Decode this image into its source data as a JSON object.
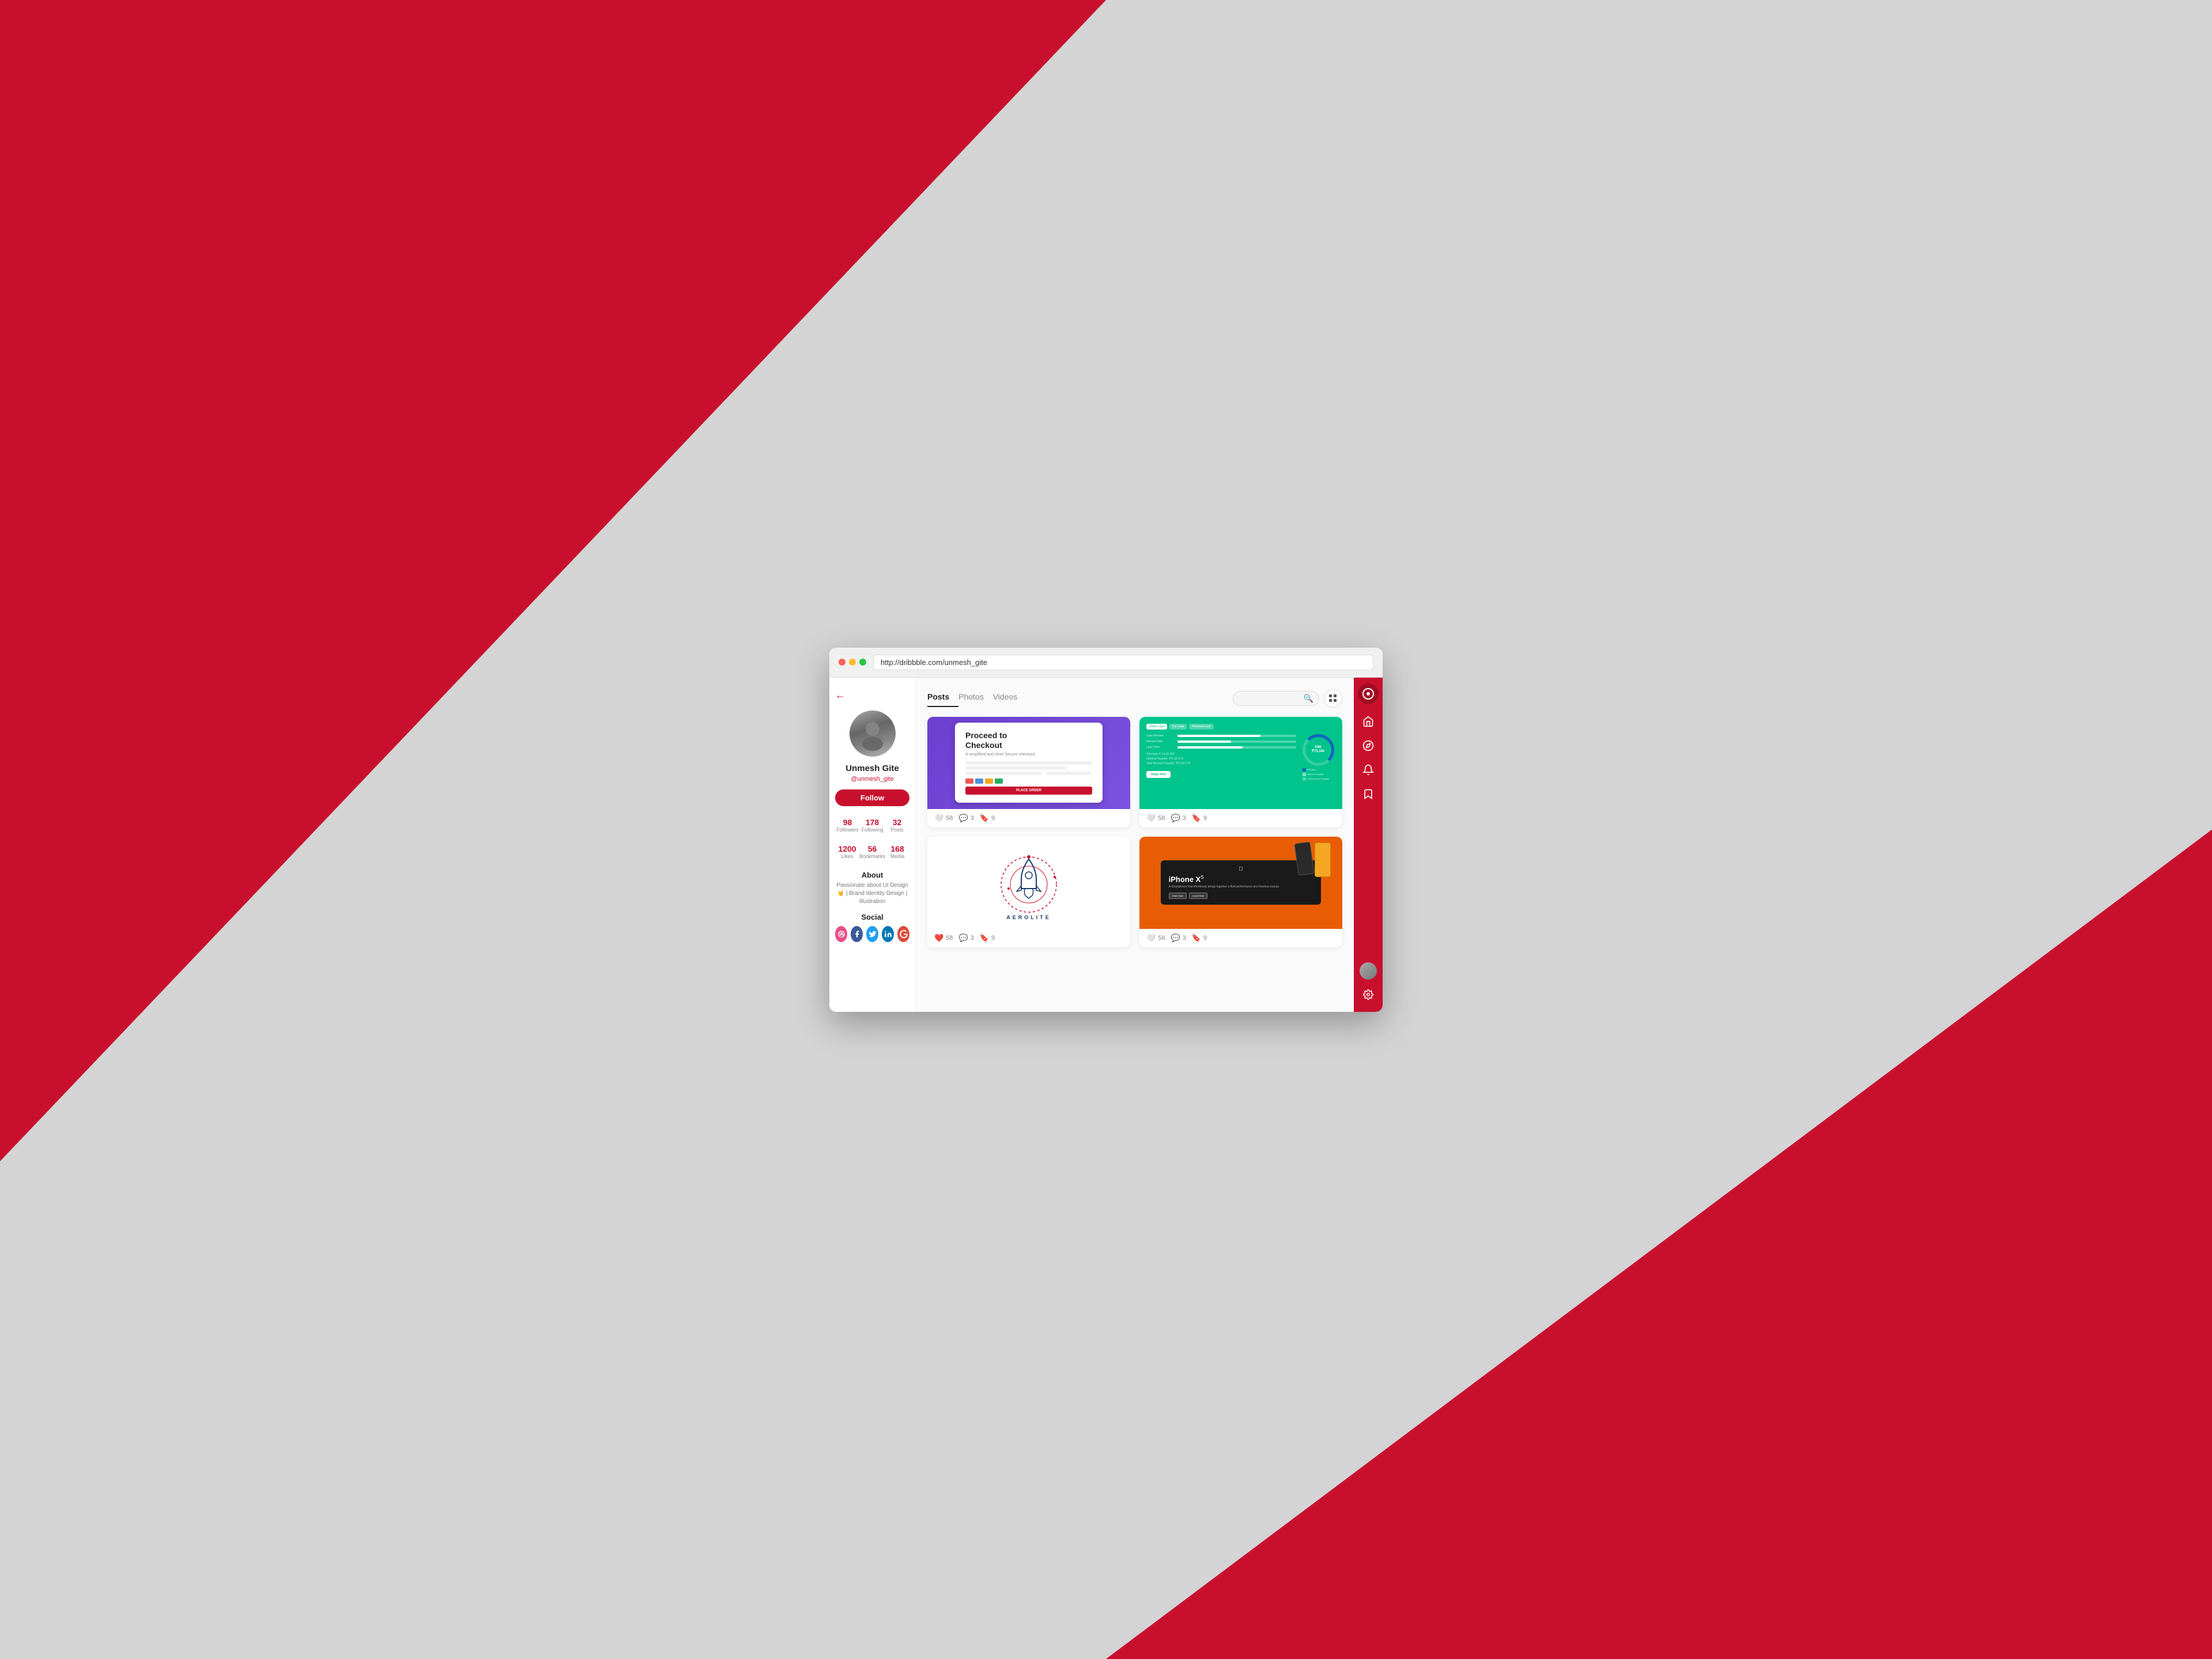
{
  "browser": {
    "url": "http://dribbble.com/unmesh_gite",
    "dots": [
      "red",
      "yellow",
      "green"
    ]
  },
  "profile": {
    "name": "Unmesh Gite",
    "username": "@unmesh_gite",
    "follow_label": "Follow",
    "stats": [
      {
        "value": "98",
        "label": "Followers"
      },
      {
        "value": "178",
        "label": "Following"
      },
      {
        "value": "32",
        "label": "Posts"
      }
    ],
    "stats2": [
      {
        "value": "1200",
        "label": "Likes"
      },
      {
        "value": "56",
        "label": "Bookmarks"
      },
      {
        "value": "168",
        "label": "Media"
      }
    ],
    "about_title": "About",
    "about_text": "Passionate about UI Design 🤘 | Brand Identity Design | Illustration",
    "social_title": "Social",
    "social_links": [
      "dribbble",
      "facebook",
      "twitter",
      "linkedin",
      "google"
    ]
  },
  "tabs": [
    {
      "label": "Posts",
      "active": true
    },
    {
      "label": "Photos",
      "active": false
    },
    {
      "label": "Videos",
      "active": false
    }
  ],
  "search": {
    "placeholder": ""
  },
  "posts": [
    {
      "type": "checkout",
      "title": "Proceed to Checkout",
      "subtitle": "A simplified and short Secure checkout",
      "likes": 58,
      "comments": 3,
      "bookmarks": 9,
      "liked": false
    },
    {
      "type": "loan",
      "title": "Loan Calculator",
      "likes": 58,
      "comments": 3,
      "bookmarks": 9,
      "liked": false
    },
    {
      "type": "rocket",
      "title": "Aerolite Logo",
      "likes": 58,
      "comments": 3,
      "bookmarks": 9,
      "liked": true
    },
    {
      "type": "iphone",
      "title": "iPhone XS",
      "subtitle": "A Smartphone that effortlessly brings together a fluid performance and timeless beauty.",
      "likes": 58,
      "comments": 3,
      "bookmarks": 9,
      "liked": false
    }
  ],
  "nav": {
    "items": [
      {
        "icon": "🏠",
        "name": "home"
      },
      {
        "icon": "🧭",
        "name": "explore"
      },
      {
        "icon": "🔔",
        "name": "notifications"
      },
      {
        "icon": "🔖",
        "name": "bookmarks"
      }
    ]
  }
}
